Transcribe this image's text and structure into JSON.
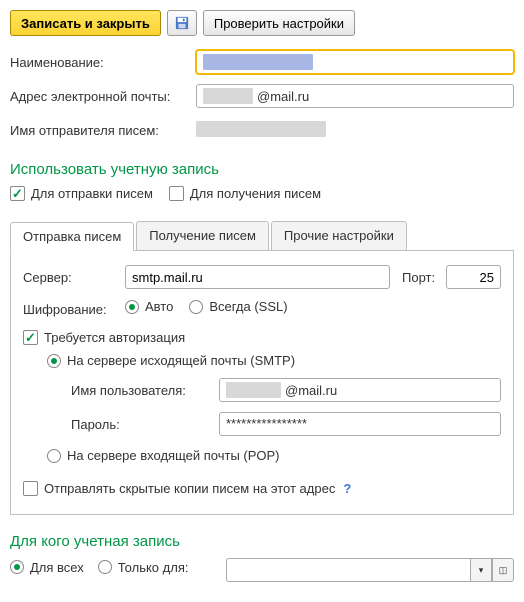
{
  "toolbar": {
    "save_close": "Записать и закрыть",
    "check_settings": "Проверить настройки"
  },
  "fields": {
    "name_label": "Наименование:",
    "email_label": "Адрес электронной почты:",
    "email_suffix": "@mail.ru",
    "sender_label": "Имя отправителя писем:"
  },
  "use_account": {
    "header": "Использовать учетную запись",
    "for_send": "Для отправки писем",
    "for_receive": "Для получения писем"
  },
  "tabs": {
    "send": "Отправка писем",
    "receive": "Получение писем",
    "other": "Прочие настройки"
  },
  "send_tab": {
    "server_label": "Сервер:",
    "server_value": "smtp.mail.ru",
    "port_label": "Порт:",
    "port_value": "25",
    "encryption_label": "Шифрование:",
    "enc_auto": "Авто",
    "enc_always": "Всегда (SSL)",
    "auth_required": "Требуется авторизация",
    "auth_smtp": "На сервере исходящей почты (SMTP)",
    "user_label": "Имя пользователя:",
    "user_suffix": "@mail.ru",
    "password_label": "Пароль:",
    "password_value": "****************",
    "auth_pop": "На сервере входящей почты (POP)",
    "bcc_label": "Отправлять скрытые копии писем на этот адрес",
    "help": "?"
  },
  "for_whom": {
    "header": "Для кого учетная запись",
    "for_all": "Для всех",
    "only_for": "Только для:"
  },
  "icons": {
    "dropdown": "▾",
    "expand": "◫"
  }
}
